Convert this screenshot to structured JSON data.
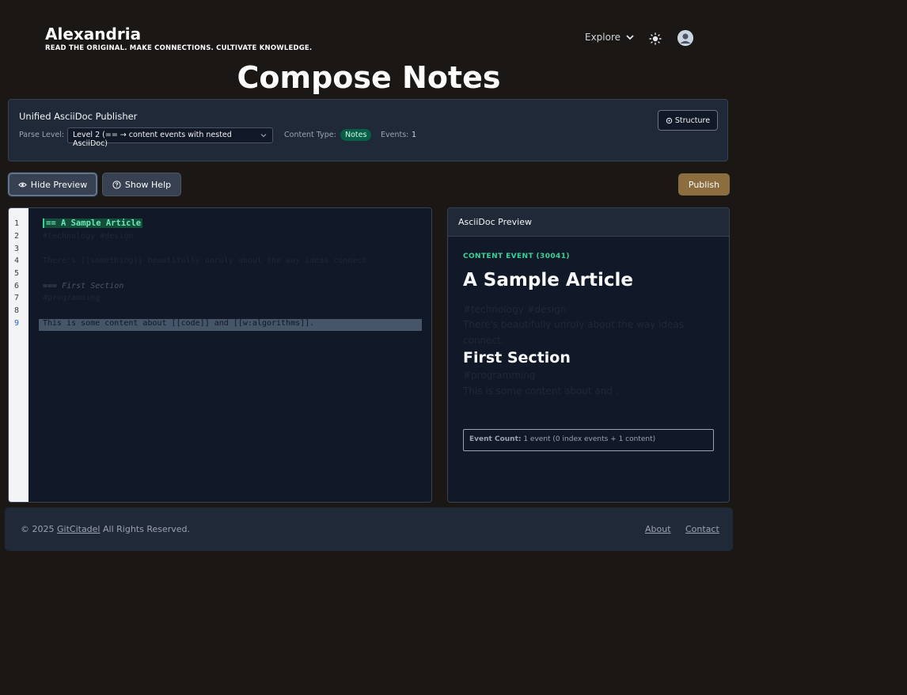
{
  "header": {
    "brand": "Alexandria",
    "tagline": "READ THE ORIGINAL. MAKE CONNECTIONS. CULTIVATE KNOWLEDGE.",
    "explore_label": "Explore",
    "theme_icon": "sun-icon",
    "avatar_icon": "user-avatar-icon"
  },
  "page_title": "Compose Notes",
  "publisher": {
    "title": "Unified AsciiDoc Publisher",
    "parse_level_label": "Parse Level:",
    "parse_level_value": "Level 2 (== → content events with nested AsciiDoc)",
    "content_type_label": "Content Type:",
    "content_type_value": "Notes",
    "events_label": "Events:",
    "events_value": "1",
    "structure_button": "Structure"
  },
  "toolbar": {
    "hide_preview": "Hide Preview",
    "show_help": "Show Help",
    "publish": "Publish"
  },
  "editor": {
    "line_numbers": [
      "1",
      "2",
      "3",
      "4",
      "5",
      "6",
      "7",
      "8",
      "9"
    ],
    "lines": [
      "== A Sample Article",
      "#technology #design",
      "",
      "There's [[something]] beautifully unruly about the way ideas connect.",
      "",
      "=== First Section",
      "#programming",
      "",
      "This is some content about [[code]] and [[w:algorithms]]."
    ],
    "active_line": 9
  },
  "preview": {
    "header": "AsciiDoc Preview",
    "event_kind": "CONTENT EVENT (30041)",
    "title": "A Sample Article",
    "tags1": "#technology #design",
    "para1": "There's beautifully unruly about the way ideas",
    "para1_cont": "connect.",
    "section_title": "First Section",
    "tags2": "#programming",
    "para2": "This is some content about and .",
    "event_count_label": "Event Count:",
    "event_count_value": "1 event (0 index events + 1 content)"
  },
  "footer": {
    "copyright_prefix": "© 2025",
    "copyright_link": "GitCitadel",
    "copyright_suffix": "All Rights Reserved.",
    "about": "About",
    "contact": "Contact"
  },
  "colors": {
    "background": "#1a1714",
    "panel": "#1f2937",
    "accent_green": "#34d399",
    "publish": "#8c6d3f"
  }
}
